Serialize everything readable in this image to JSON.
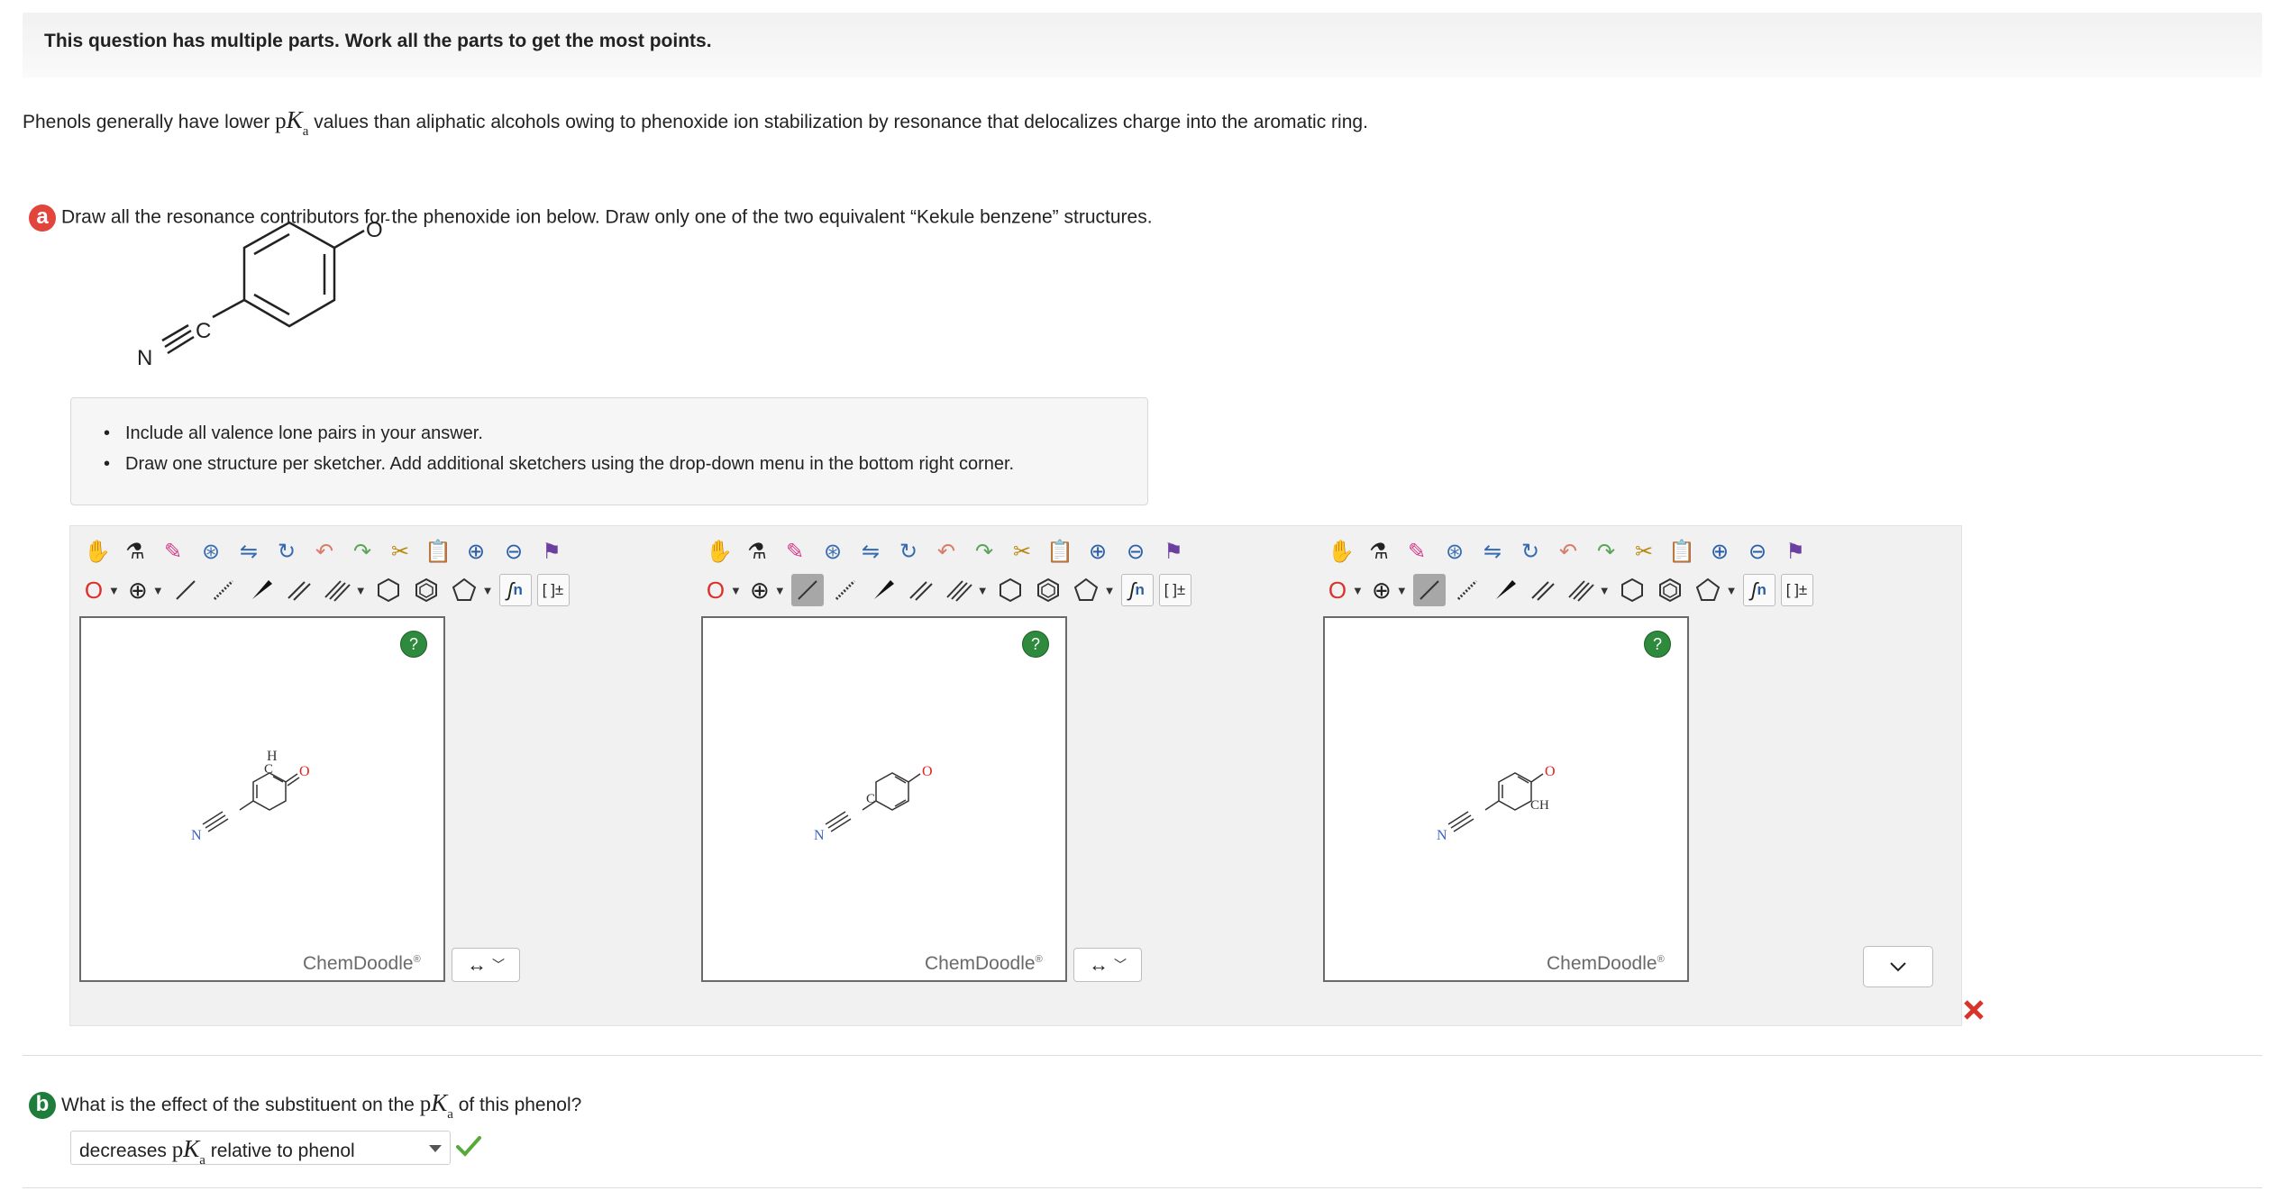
{
  "banner": "This question has multiple parts. Work all the parts to get the most points.",
  "intro": {
    "before": "Phenols generally have lower ",
    "p": "p",
    "K": "K",
    "sub": "a",
    "after": " values than aliphatic alcohols owing to phenoxide ion stabilization by resonance that delocalizes charge into the aromatic ring."
  },
  "part_a": {
    "badge": "a",
    "prompt": "Draw all the resonance contributors for the phenoxide ion below. Draw only one of the two equivalent “Kekule benzene” structures.",
    "molecule_labels": {
      "oxygen": "O",
      "charge": "-",
      "nitrogen": "N",
      "carbon": "C"
    },
    "notes": [
      "Include all valence lone pairs in your answer.",
      "Draw one structure per sketcher. Add additional sketchers using the drop-down menu in the bottom right corner."
    ],
    "toolbar": {
      "row1_icons": [
        "hand-icon",
        "bottle-icon",
        "eraser-icon",
        "ring-gear-icon",
        "flip-icon",
        "rotate-icon",
        "undo-icon",
        "redo-icon",
        "cut-icon",
        "paste-icon",
        "zoom-in-icon",
        "zoom-out-icon",
        "clean-icon"
      ],
      "element_label": "O",
      "charge_label": "⊕",
      "sgroup_label": "n",
      "bracket_label": "[ ]±"
    },
    "sketchers": [
      {
        "labels": [
          "H",
          "C",
          "O",
          "N"
        ],
        "brand": "ChemDoodle",
        "help": "?"
      },
      {
        "labels": [
          "C",
          "O",
          "N"
        ],
        "brand": "ChemDoodle",
        "help": "?"
      },
      {
        "labels": [
          "CH",
          "O",
          "N"
        ],
        "brand": "ChemDoodle",
        "help": "?"
      }
    ],
    "arrow_selects": [
      "↔",
      "↔"
    ],
    "status": "incorrect"
  },
  "part_b": {
    "badge": "b",
    "q_before": "What is the effect of the substituent on the ",
    "p": "p",
    "K": "K",
    "sub": "a",
    "q_after": " of this phenol?",
    "answer_before": "decreases ",
    "answer_after": " relative to phenol",
    "status": "correct"
  },
  "colors": {
    "badge_a": "#e2453c",
    "badge_b": "#1e7d3a",
    "correct": "#5aa83a",
    "incorrect": "#d9342b",
    "help": "#2e8a3c"
  }
}
